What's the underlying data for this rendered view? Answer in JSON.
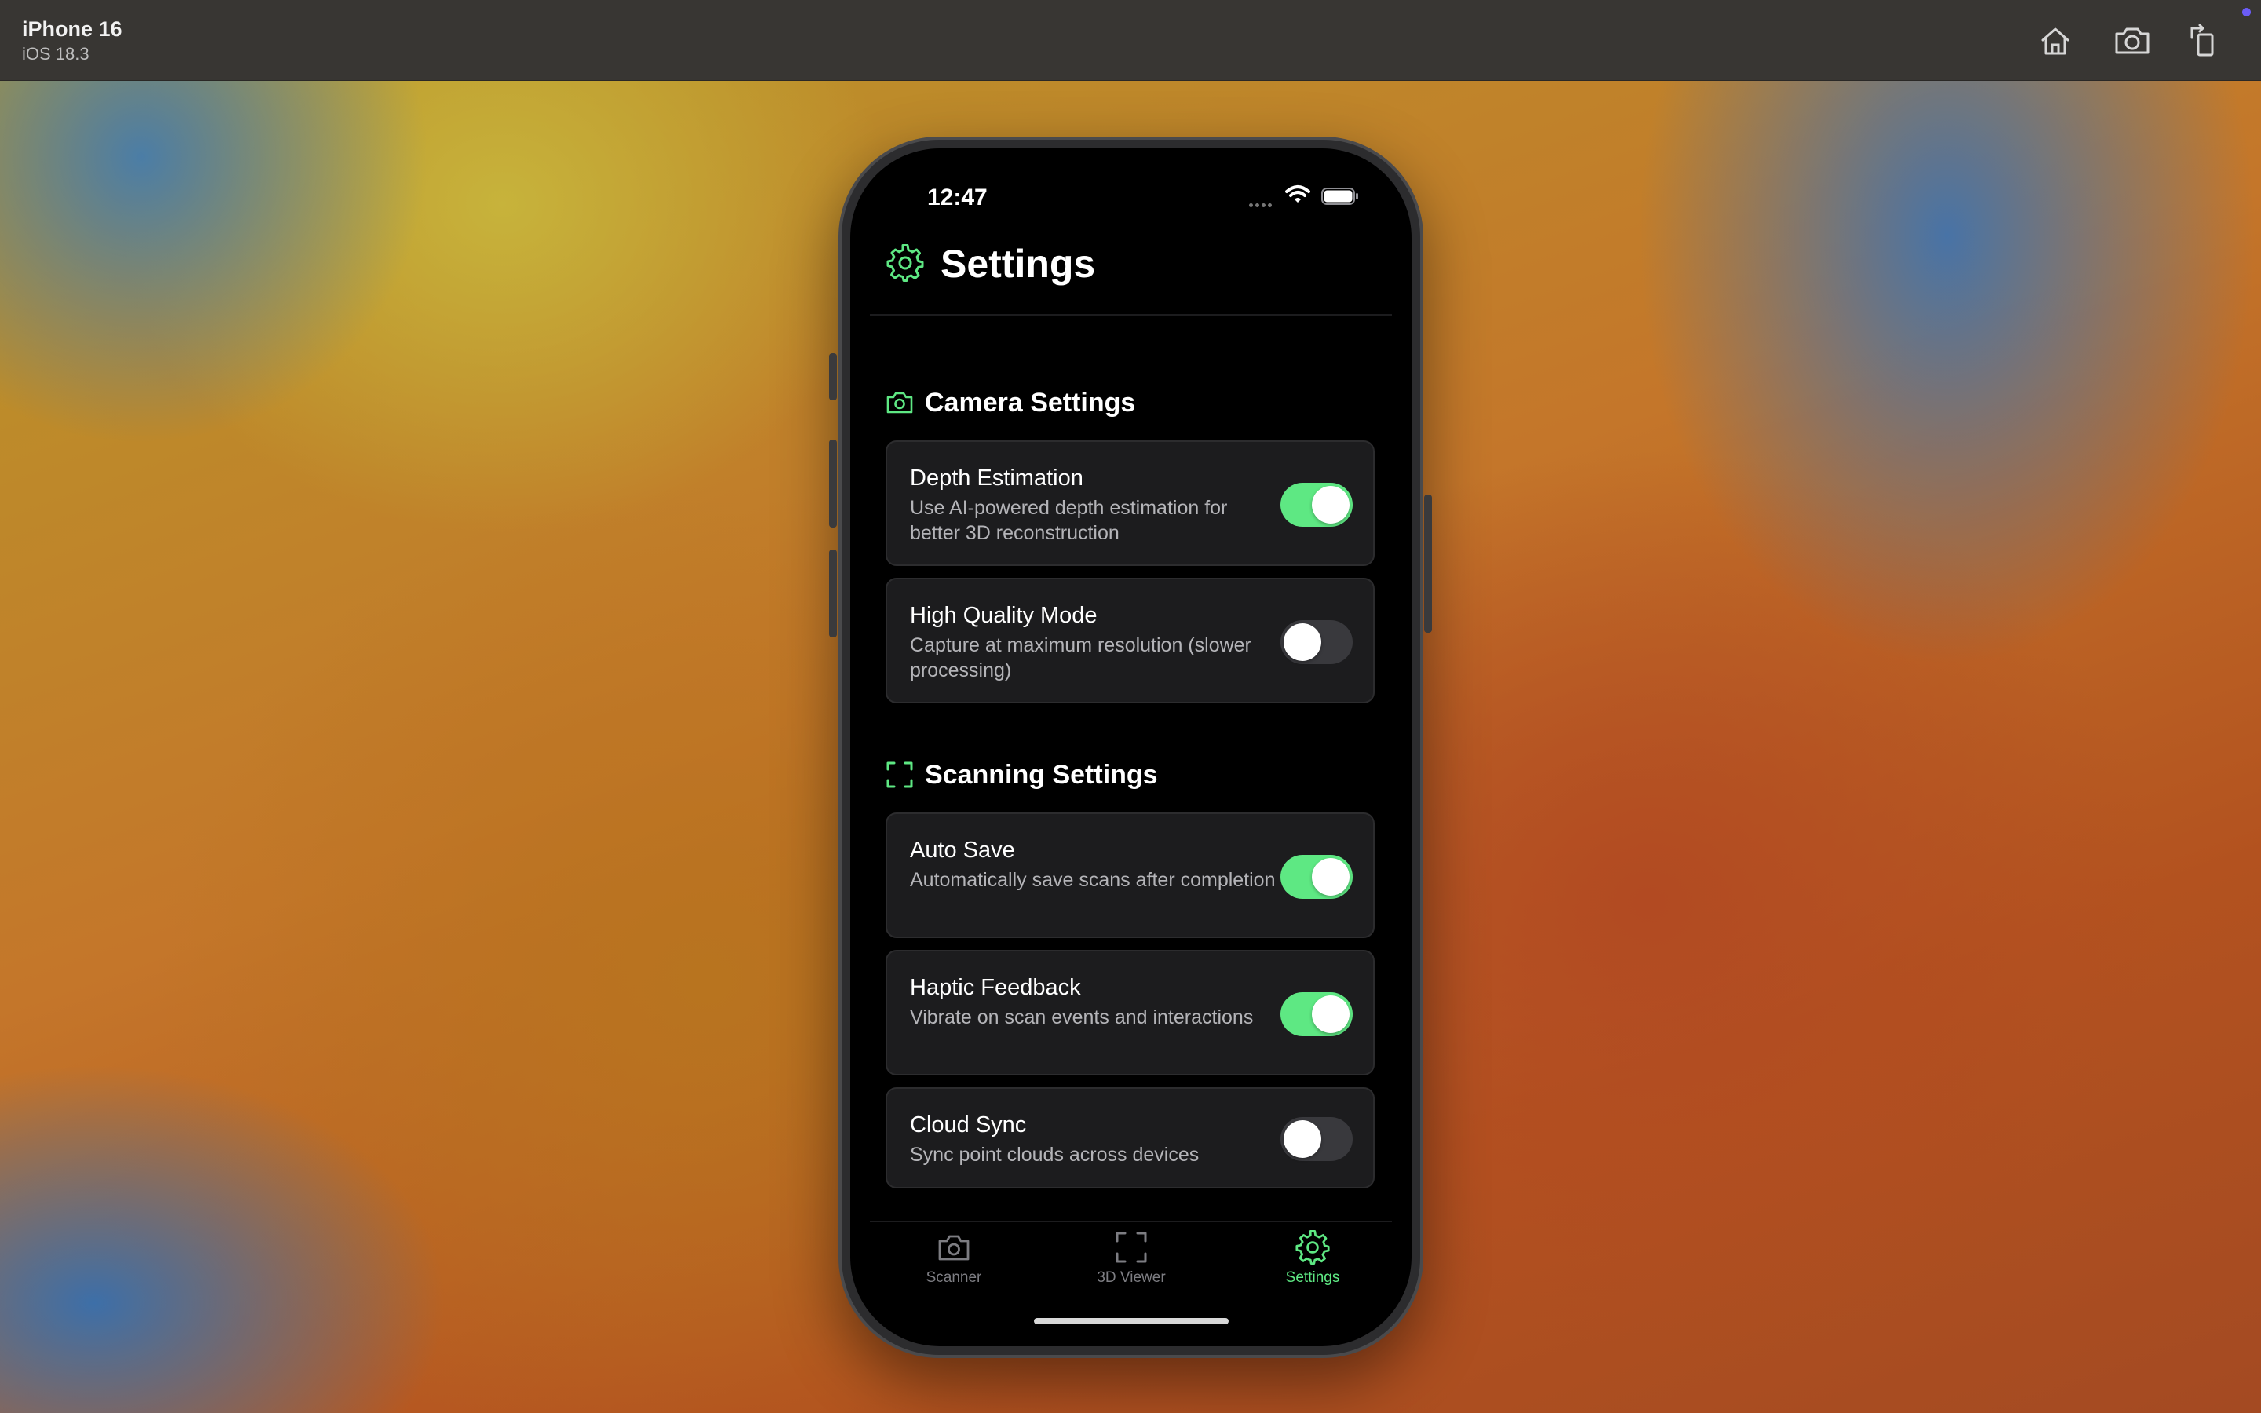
{
  "simulator": {
    "device_name": "iPhone 16",
    "os_version": "iOS 18.3",
    "toolbar": [
      {
        "icon": "home-icon"
      },
      {
        "icon": "screenshot-camera-icon"
      },
      {
        "icon": "rotate-device-icon"
      }
    ]
  },
  "status_bar": {
    "time": "12:47"
  },
  "header": {
    "title": "Settings",
    "icon": "gear-icon",
    "accent_color": "#5ee883"
  },
  "sections": [
    {
      "title": "Camera Settings",
      "icon": "camera-icon",
      "items": [
        {
          "title": "Depth Estimation",
          "description": "Use AI-powered depth estimation for better 3D reconstruction",
          "enabled": true
        },
        {
          "title": "High Quality Mode",
          "description": "Capture at maximum resolution (slower processing)",
          "enabled": false
        }
      ]
    },
    {
      "title": "Scanning Settings",
      "icon": "scan-frame-icon",
      "items": [
        {
          "title": "Auto Save",
          "description": "Automatically save scans after completion",
          "enabled": true
        },
        {
          "title": "Haptic Feedback",
          "description": "Vibrate on scan events and interactions",
          "enabled": true
        },
        {
          "title": "Cloud Sync",
          "description": "Sync point clouds across devices",
          "enabled": false
        }
      ]
    }
  ],
  "tab_bar": {
    "tabs": [
      {
        "label": "Scanner",
        "icon": "camera-icon",
        "active": false
      },
      {
        "label": "3D Viewer",
        "icon": "scan-frame-icon",
        "active": false
      },
      {
        "label": "Settings",
        "icon": "gear-icon",
        "active": true
      }
    ]
  }
}
